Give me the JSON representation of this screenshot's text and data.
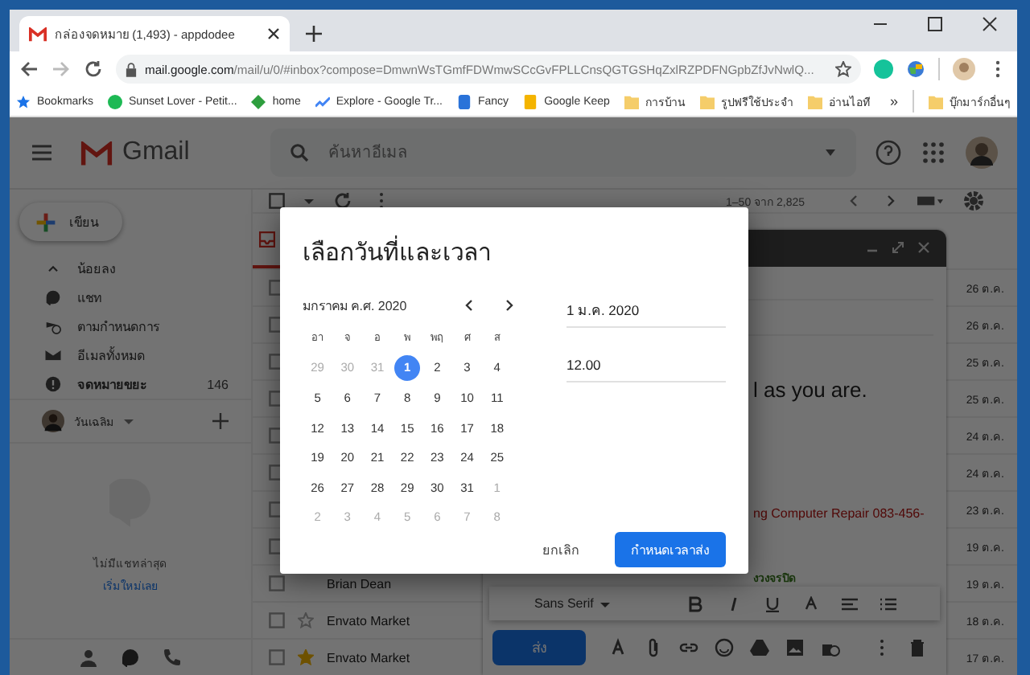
{
  "browser": {
    "tab_title": "กล่องจดหมาย (1,493) - appdodee",
    "url_host": "mail.google.com",
    "url_path": "/mail/u/0/#inbox?compose=DmwnWsTGmfFDWmwSCcGvFPLLCnsQGTGSHqZxlRZPDFNGpbZfJvNwlQ...",
    "bookmarks": [
      {
        "label": "Bookmarks",
        "kind": "star"
      },
      {
        "label": "Sunset Lover - Petit...",
        "kind": "music"
      },
      {
        "label": "home",
        "kind": "diamond"
      },
      {
        "label": "Explore - Google Tr...",
        "kind": "trend"
      },
      {
        "label": "Fancy",
        "kind": "tag"
      },
      {
        "label": "Google Keep",
        "kind": "bulb"
      },
      {
        "label": "การบ้าน",
        "kind": "folder"
      },
      {
        "label": "รูปฟรีใช้ประจำ",
        "kind": "folder"
      },
      {
        "label": "อ่านไอที",
        "kind": "folder"
      }
    ],
    "overflow": "»",
    "other_bookmarks": "บุ๊กมาร์กอื่นๆ"
  },
  "gmail": {
    "logo_text": "Gmail",
    "search_placeholder": "ค้นหาอีเมล",
    "compose_label": "เขียน",
    "sidebar": [
      {
        "label": "น้อยลง",
        "kind": "chevron"
      },
      {
        "label": "แชท",
        "kind": "chat"
      },
      {
        "label": "ตามกำหนดการ",
        "kind": "scheduled"
      },
      {
        "label": "อีเมลทั้งหมด",
        "kind": "mail"
      },
      {
        "label": "จดหมายขยะ",
        "kind": "spam",
        "count": "146"
      }
    ],
    "user": "วันเฉลิม",
    "chat_empty": "ไม่มีแชทล่าสุด",
    "chat_start": "เริ่มใหม่เลย",
    "page_range": "1–50 จาก 2,825",
    "rows": [
      {
        "date": "26 ต.ค."
      },
      {
        "date": "26 ต.ค."
      },
      {
        "date": "25 ต.ค."
      },
      {
        "date": "25 ต.ค."
      },
      {
        "date": "24 ต.ค."
      },
      {
        "date": "24 ต.ค."
      },
      {
        "date": "23 ต.ค."
      },
      {
        "date": "19 ต.ค."
      },
      {
        "sender": "Brian Dean",
        "date": "19 ต.ค."
      },
      {
        "sender": "Envato Market",
        "date": "18 ต.ค.",
        "starred": false
      },
      {
        "sender": "Envato Market",
        "date": "17 ต.ค.",
        "starred": true
      }
    ]
  },
  "compose": {
    "lines": [
      {
        "text": "l as you are.",
        "kind": "large"
      },
      {
        "text": "ng Computer Repair 083-456-",
        "kind": "red"
      },
      {
        "text": "งวงจรปิด",
        "kind": "green"
      }
    ],
    "font": "Sans Serif",
    "send": "ส่ง"
  },
  "dialog": {
    "title": "เลือกวันที่และเวลา",
    "month": "มกราคม ค.ศ. 2020",
    "weekdays": [
      "อา",
      "จ",
      "อ",
      "พ",
      "พฤ",
      "ศ",
      "ส"
    ],
    "weeks": [
      [
        {
          "day": "29",
          "in_month": false,
          "selected": false
        },
        {
          "day": "30",
          "in_month": false,
          "selected": false
        },
        {
          "day": "31",
          "in_month": false,
          "selected": false
        },
        {
          "day": "1",
          "in_month": true,
          "selected": true
        },
        {
          "day": "2",
          "in_month": true,
          "selected": false
        },
        {
          "day": "3",
          "in_month": true,
          "selected": false
        },
        {
          "day": "4",
          "in_month": true,
          "selected": false
        }
      ],
      [
        {
          "day": "5",
          "in_month": true,
          "selected": false
        },
        {
          "day": "6",
          "in_month": true,
          "selected": false
        },
        {
          "day": "7",
          "in_month": true,
          "selected": false
        },
        {
          "day": "8",
          "in_month": true,
          "selected": false
        },
        {
          "day": "9",
          "in_month": true,
          "selected": false
        },
        {
          "day": "10",
          "in_month": true,
          "selected": false
        },
        {
          "day": "11",
          "in_month": true,
          "selected": false
        }
      ],
      [
        {
          "day": "12",
          "in_month": true,
          "selected": false
        },
        {
          "day": "13",
          "in_month": true,
          "selected": false
        },
        {
          "day": "14",
          "in_month": true,
          "selected": false
        },
        {
          "day": "15",
          "in_month": true,
          "selected": false
        },
        {
          "day": "16",
          "in_month": true,
          "selected": false
        },
        {
          "day": "17",
          "in_month": true,
          "selected": false
        },
        {
          "day": "18",
          "in_month": true,
          "selected": false
        }
      ],
      [
        {
          "day": "19",
          "in_month": true,
          "selected": false
        },
        {
          "day": "20",
          "in_month": true,
          "selected": false
        },
        {
          "day": "21",
          "in_month": true,
          "selected": false
        },
        {
          "day": "22",
          "in_month": true,
          "selected": false
        },
        {
          "day": "23",
          "in_month": true,
          "selected": false
        },
        {
          "day": "24",
          "in_month": true,
          "selected": false
        },
        {
          "day": "25",
          "in_month": true,
          "selected": false
        }
      ],
      [
        {
          "day": "26",
          "in_month": true,
          "selected": false
        },
        {
          "day": "27",
          "in_month": true,
          "selected": false
        },
        {
          "day": "28",
          "in_month": true,
          "selected": false
        },
        {
          "day": "29",
          "in_month": true,
          "selected": false
        },
        {
          "day": "30",
          "in_month": true,
          "selected": false
        },
        {
          "day": "31",
          "in_month": true,
          "selected": false
        },
        {
          "day": "1",
          "in_month": false,
          "selected": false
        }
      ],
      [
        {
          "day": "2",
          "in_month": false,
          "selected": false
        },
        {
          "day": "3",
          "in_month": false,
          "selected": false
        },
        {
          "day": "4",
          "in_month": false,
          "selected": false
        },
        {
          "day": "5",
          "in_month": false,
          "selected": false
        },
        {
          "day": "6",
          "in_month": false,
          "selected": false
        },
        {
          "day": "7",
          "in_month": false,
          "selected": false
        },
        {
          "day": "8",
          "in_month": false,
          "selected": false
        }
      ]
    ],
    "date_value": "1 ม.ค. 2020",
    "time_value": "12.00",
    "cancel": "ยกเลิก",
    "confirm": "กำหนดเวลาส่ง"
  }
}
